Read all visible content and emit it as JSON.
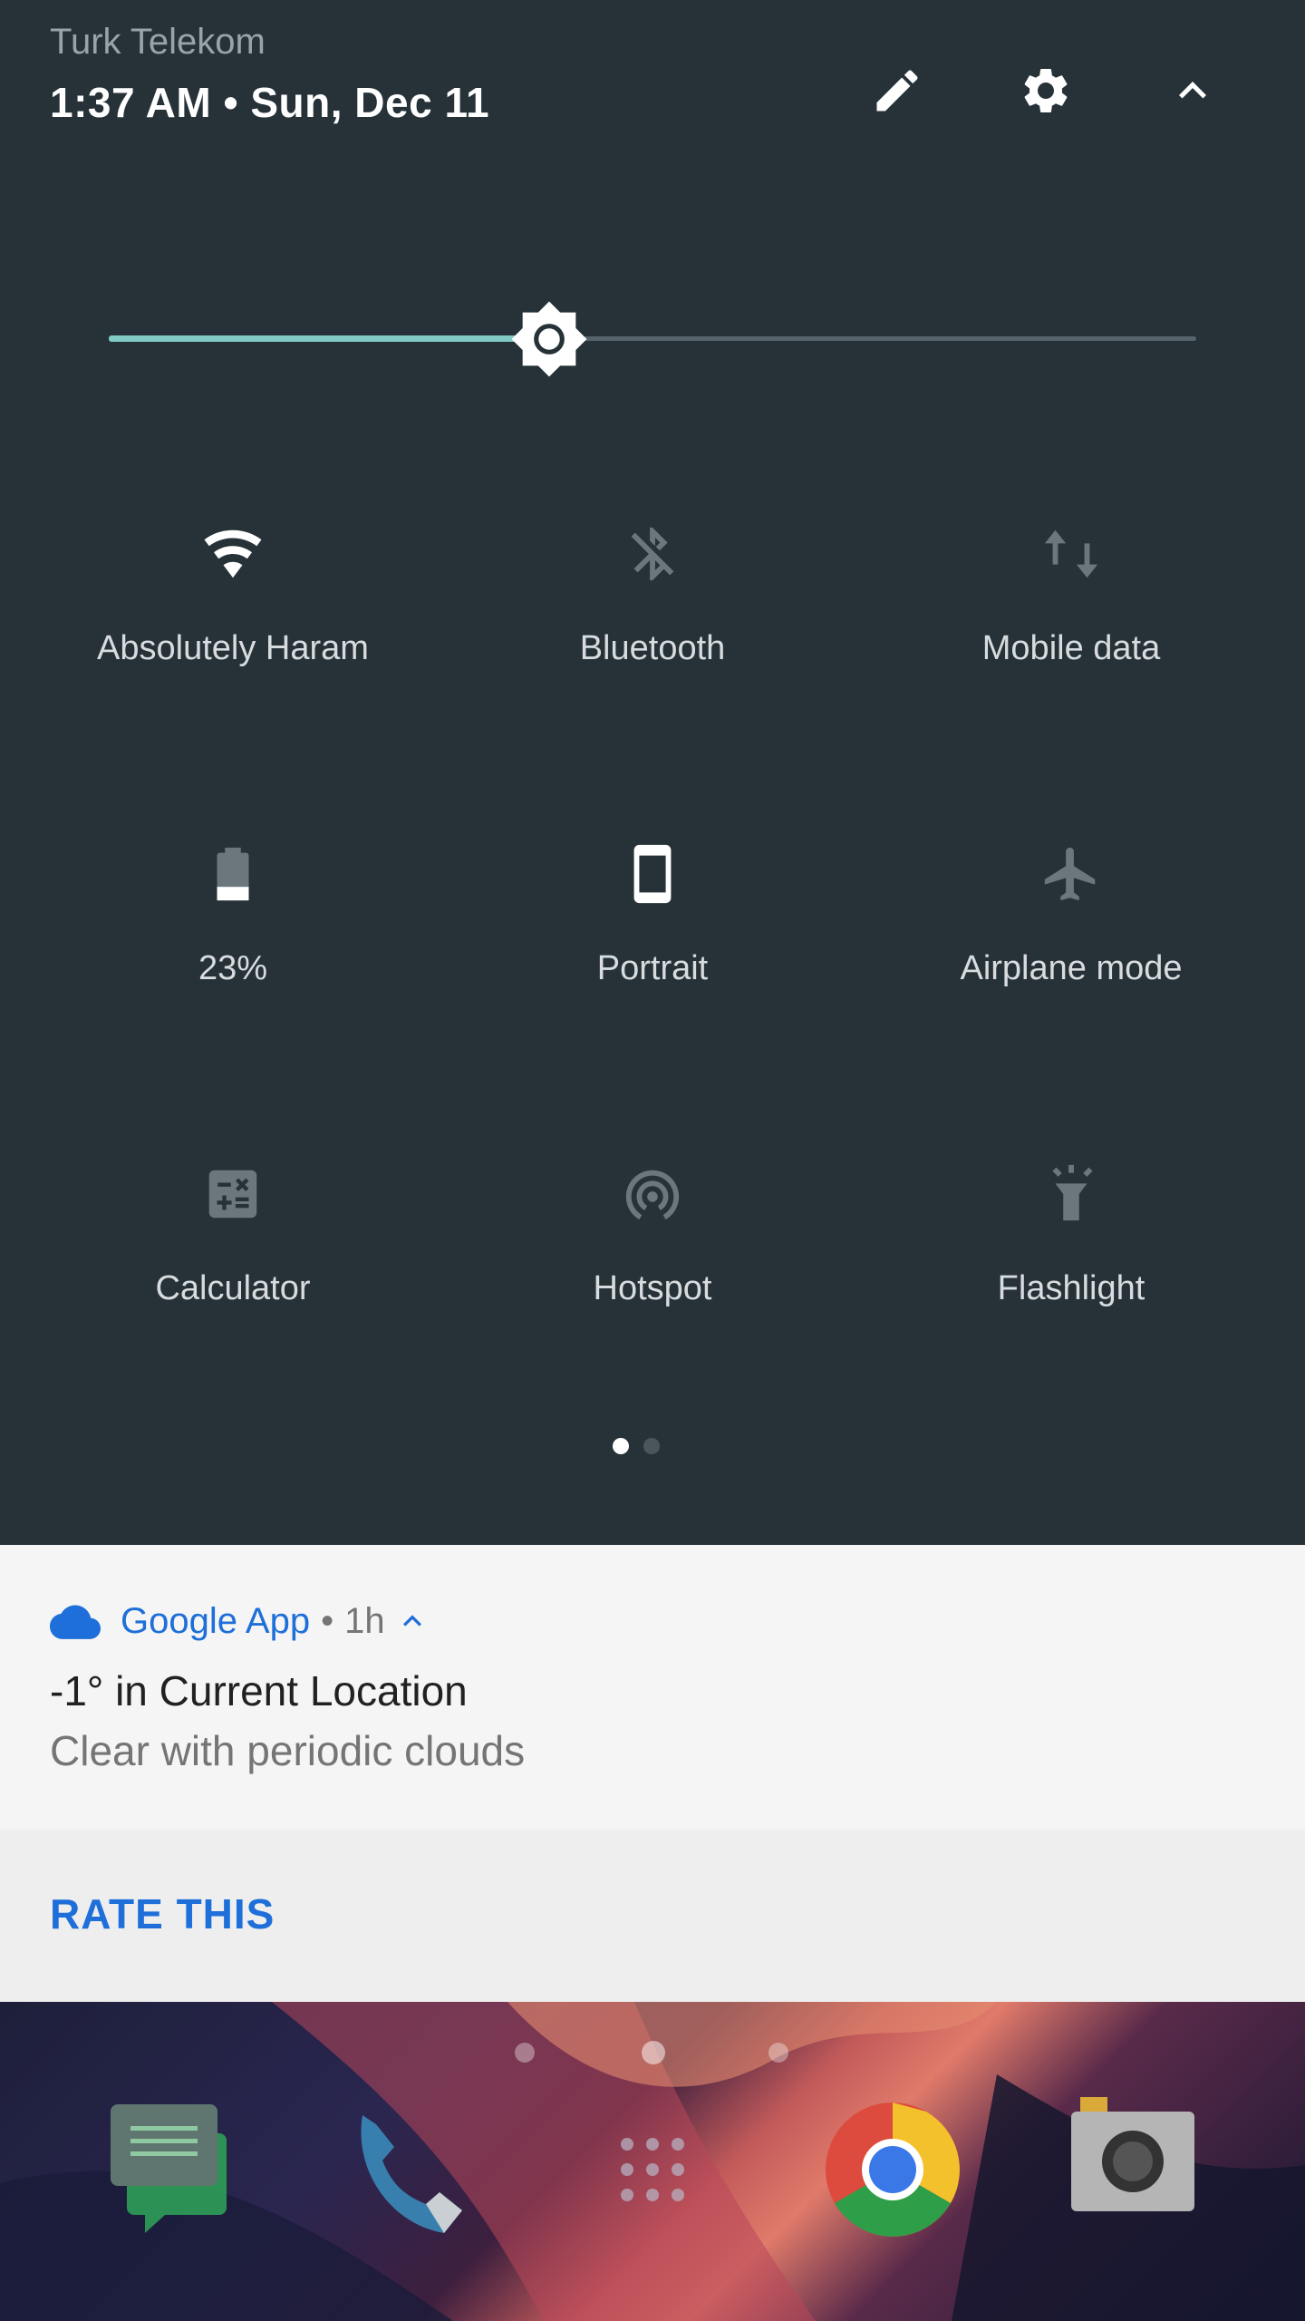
{
  "status": {
    "carrier": "Turk Telekom",
    "datetime": "1:37 AM • Sun, Dec 11"
  },
  "header_buttons": [
    {
      "name": "edit-button",
      "icon": "pencil-icon"
    },
    {
      "name": "settings-button",
      "icon": "gear-icon"
    },
    {
      "name": "collapse-button",
      "icon": "chevron-up-icon"
    }
  ],
  "brightness": {
    "level": 0.405,
    "fill_color": "#80cbc4",
    "track_color": "#56636a"
  },
  "tiles": [
    {
      "label": "Absolutely Haram",
      "icon": "wifi-icon",
      "state": "on"
    },
    {
      "label": "Bluetooth",
      "icon": "bluetooth-off-icon",
      "state": "off"
    },
    {
      "label": "Mobile data",
      "icon": "mobile-data-icon",
      "state": "off"
    },
    {
      "label": "23%",
      "icon": "battery-icon",
      "state": "off",
      "level": 0.23
    },
    {
      "label": "Portrait",
      "icon": "portrait-phone-icon",
      "state": "on"
    },
    {
      "label": "Airplane mode",
      "icon": "airplane-icon",
      "state": "off"
    },
    {
      "label": "Calculator",
      "icon": "calculator-icon",
      "state": "off"
    },
    {
      "label": "Hotspot",
      "icon": "hotspot-icon",
      "state": "off"
    },
    {
      "label": "Flashlight",
      "icon": "flashlight-icon",
      "state": "off"
    }
  ],
  "page_indicator": {
    "pages": 2,
    "current": 1
  },
  "notification": {
    "app_icon": "cloud-icon",
    "app_name": "Google App",
    "separator": "•",
    "time": "1h",
    "expand_icon": "chevron-up-icon",
    "title": "-1° in Current Location",
    "text": "Clear with periodic clouds",
    "accent_color": "#1e6fd9",
    "action_label": "RATE THIS"
  },
  "dock": {
    "apps": [
      "messages-icon",
      "phone-icon",
      "app-drawer-icon",
      "chrome-icon",
      "camera-icon"
    ]
  }
}
